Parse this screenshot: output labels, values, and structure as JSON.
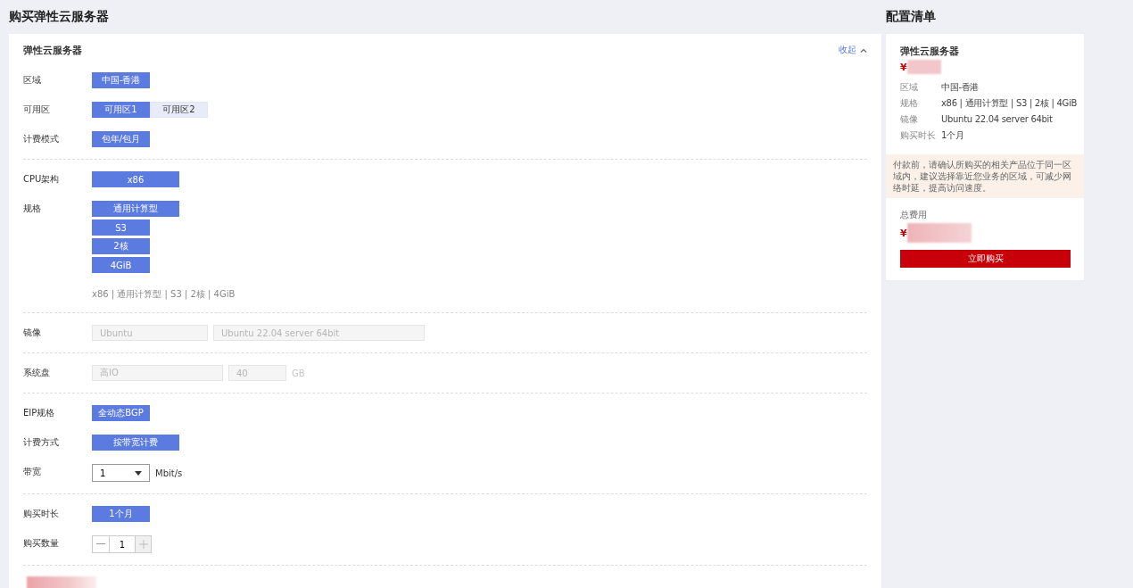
{
  "page_title": "购买弹性云服务器",
  "main_card": {
    "title": "弹性云服务器",
    "collapse_link": "收起",
    "sections": [
      {
        "rows": [
          {
            "label": "区域",
            "kind": "options",
            "options": [
              {
                "label": "中国-香港",
                "selected": true
              }
            ]
          },
          {
            "label": "可用区",
            "kind": "options",
            "options": [
              {
                "label": "可用区1",
                "selected": true
              },
              {
                "label": "可用区2",
                "selected": false
              }
            ]
          },
          {
            "label": "计费模式",
            "kind": "options",
            "options": [
              {
                "label": "包年/包月",
                "selected": true
              }
            ]
          }
        ]
      },
      {
        "rows": [
          {
            "label": "CPU架构",
            "kind": "wide",
            "options": [
              {
                "label": "x86",
                "selected": true
              }
            ]
          },
          {
            "label": "规格",
            "kind": "stack",
            "options": [
              {
                "label": "通用计算型",
                "selected": true
              },
              {
                "label": "S3",
                "selected": true
              },
              {
                "label": "2核",
                "selected": true
              },
              {
                "label": "4GiB",
                "selected": true
              }
            ],
            "summary": "x86 | 通用计算型 | S3 | 2核 | 4GiB"
          }
        ]
      },
      {
        "rows": [
          {
            "label": "镜像",
            "kind": "fields",
            "fields": [
              {
                "value": "Ubuntu",
                "disabled": true
              },
              {
                "value": "Ubuntu 22.04 server 64bit",
                "disabled": true
              }
            ]
          }
        ]
      },
      {
        "rows": [
          {
            "label": "系统盘",
            "kind": "fields",
            "fields": [
              {
                "value": "高IO",
                "disabled": true
              },
              {
                "value": "40",
                "disabled": true
              }
            ],
            "unit": "GB"
          }
        ]
      },
      {
        "rows": [
          {
            "label": "EIP规格",
            "kind": "options",
            "options": [
              {
                "label": "全动态BGP",
                "selected": true
              }
            ]
          },
          {
            "label": "计费方式",
            "kind": "wide",
            "options": [
              {
                "label": "按带宽计费",
                "selected": true
              }
            ]
          },
          {
            "label": "带宽",
            "kind": "select",
            "value": "1",
            "unit": "Mbit/s"
          }
        ]
      },
      {
        "rows": [
          {
            "label": "购买时长",
            "kind": "options",
            "options": [
              {
                "label": "1个月",
                "selected": true
              }
            ]
          },
          {
            "label": "购买数量",
            "kind": "stepper",
            "value": "1"
          }
        ]
      }
    ]
  },
  "summary_title": "配置清单",
  "summary_card": {
    "title": "弹性云服务器",
    "price_symbol": "¥",
    "details": [
      {
        "label": "区域",
        "value": "中国-香港"
      },
      {
        "label": "规格",
        "value": "x86 | 通用计算型 | S3 | 2核 | 4GiB"
      },
      {
        "label": "镜像",
        "value": "Ubuntu 22.04 server 64bit"
      },
      {
        "label": "购买时长",
        "value": "1个月"
      }
    ],
    "notice": "付款前，请确认所购买的相关产品位于同一区域内，建议选择靠近您业务的区域，可减少网络时延，提高访问速度。",
    "total_label": "总费用",
    "total_symbol": "¥",
    "buy_button": "立即购买"
  }
}
